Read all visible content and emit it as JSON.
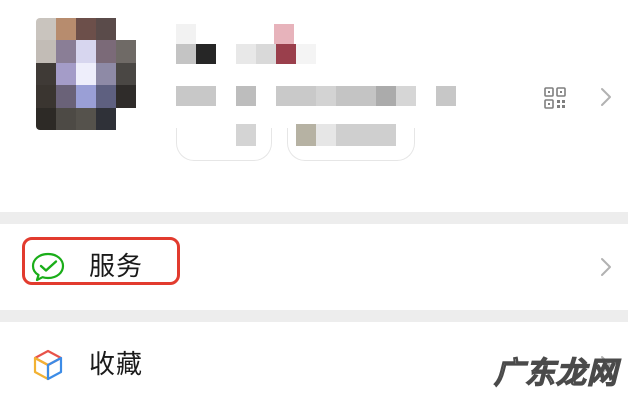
{
  "profile": {
    "avatar_alt": "avatar-redacted",
    "qr_icon": "qr-code-icon",
    "chevron_icon": "chevron-right-icon"
  },
  "menu": {
    "items": [
      {
        "label": "服务",
        "icon": "wechat-pay-check-icon",
        "accent": "#1aad19"
      },
      {
        "label": "收藏",
        "icon": "favorites-cube-icon",
        "accent": "#3c8ce7"
      }
    ],
    "chevron_icon": "chevron-right-icon"
  },
  "annotation": {
    "highlight_color": "#e23b2e"
  },
  "watermark": {
    "text": "广东龙网"
  }
}
